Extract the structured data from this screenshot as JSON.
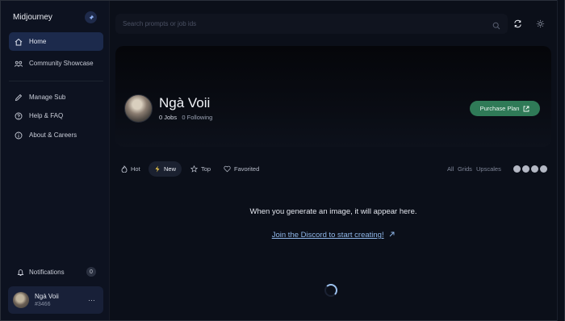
{
  "sidebar": {
    "brand": "Midjourney",
    "nav": [
      {
        "label": "Home",
        "icon": "home-icon"
      },
      {
        "label": "Community Showcase",
        "icon": "community-icon"
      },
      {
        "label": "Manage Sub",
        "icon": "edit-icon"
      },
      {
        "label": "Help & FAQ",
        "icon": "help-icon"
      },
      {
        "label": "About & Careers",
        "icon": "info-icon"
      }
    ],
    "notifications": {
      "label": "Notifications",
      "count": "0"
    },
    "user": {
      "name": "Ngà Voii",
      "tag": "#3466",
      "more": "…"
    }
  },
  "search": {
    "placeholder": "Search prompts or job ids"
  },
  "profile": {
    "name": "Ngà Voii",
    "jobs_count": "0",
    "jobs_label": "Jobs",
    "following_count": "0",
    "following_label": "Following",
    "purchase_label": "Purchase Plan"
  },
  "tabs": [
    {
      "label": "Hot",
      "icon": "flame-icon"
    },
    {
      "label": "New",
      "icon": "bolt-icon"
    },
    {
      "label": "Top",
      "icon": "star-icon"
    },
    {
      "label": "Favorited",
      "icon": "heart-icon"
    }
  ],
  "filters": {
    "all": "All",
    "grids": "Grids",
    "upscales": "Upscales"
  },
  "empty": {
    "message": "When you generate an image, it will appear here.",
    "discord_link": "Join the Discord to start creating!"
  },
  "colors": {
    "accent": "#2f7a57",
    "active_nav": "#1c2a4c",
    "link": "#8fb6e8"
  }
}
